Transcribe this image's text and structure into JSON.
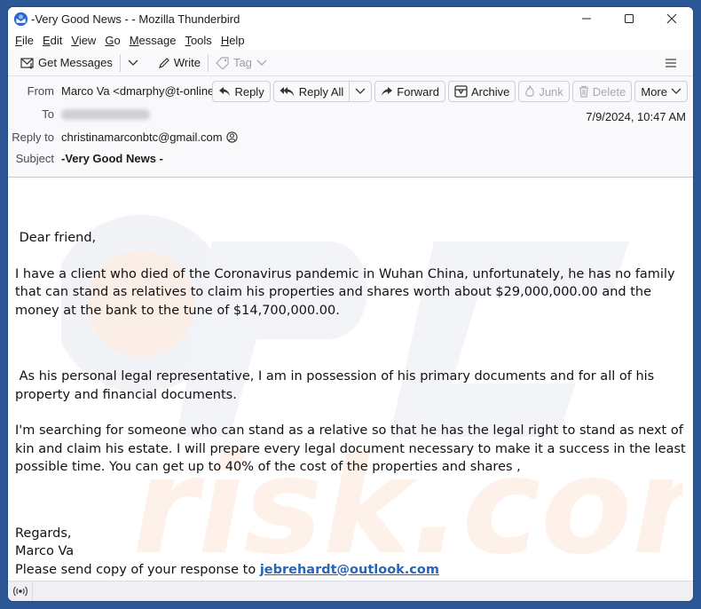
{
  "window": {
    "title": "-Very Good News - - Mozilla Thunderbird",
    "controls": [
      "minimize",
      "maximize",
      "close"
    ]
  },
  "menubar": {
    "items": [
      {
        "label": "File",
        "accel": "F"
      },
      {
        "label": "Edit",
        "accel": "E"
      },
      {
        "label": "View",
        "accel": "V"
      },
      {
        "label": "Go",
        "accel": "G"
      },
      {
        "label": "Message",
        "accel": "M"
      },
      {
        "label": "Tools",
        "accel": "T"
      },
      {
        "label": "Help",
        "accel": "H"
      }
    ]
  },
  "toolbar": {
    "get_messages": "Get Messages",
    "write": "Write",
    "tag": "Tag"
  },
  "header": {
    "from_label": "From",
    "from_value": "Marco Va <dmarphy@t-online.de>",
    "to_label": "To",
    "to_value": "",
    "reply_to_label": "Reply to",
    "reply_to_value": "christinamarconbtc@gmail.com",
    "subject_label": "Subject",
    "subject_value": "-Very Good News -",
    "date": "7/9/2024, 10:47 AM",
    "actions": {
      "reply": "Reply",
      "reply_all": "Reply All",
      "forward": "Forward",
      "archive": "Archive",
      "junk": "Junk",
      "delete": "Delete",
      "more": "More"
    }
  },
  "message": {
    "greeting": " Dear friend,",
    "p1": "I have a client who  died of the Coronavirus pandemic in Wuhan China, unfortunately, he has no family that can stand as relatives to claim his properties and shares worth about $29,000,000.00 and the money at the bank to the tune of $14,700,000.00.",
    "p2": " As his personal legal representative, I am in possession of his primary documents and for all of his property and financial documents.",
    "p3": "I'm searching for someone who can stand as a relative so that he has the legal right to stand as next of kin and claim his estate. I will prepare every legal document necessary to make it a success in the least possible time. You can get up to 40% of the cost of the properties and shares ,",
    "regards": "Regards,",
    "signature": "Marco Va",
    "closing_text": "Please send copy of your response to ",
    "closing_link": "jebrehardt@outlook.com"
  },
  "colors": {
    "desktop": "#2b5797",
    "link": "#2a64b8"
  }
}
